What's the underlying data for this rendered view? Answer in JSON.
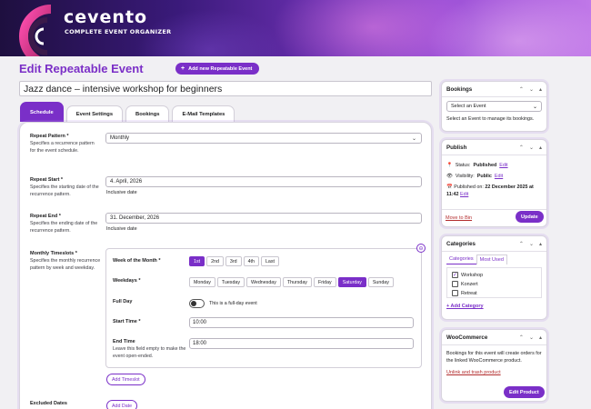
{
  "brand": {
    "name": "cevento",
    "tagline": "COMPLETE EVENT ORGANIZER",
    "accent": "#7a2fc8"
  },
  "header": {
    "title": "Edit Repeatable Event",
    "add_new_label": "Add new Repeatable Event"
  },
  "event_title": "Jazz dance – intensive workshop for beginners",
  "tabs": [
    {
      "label": "Schedule",
      "active": true
    },
    {
      "label": "Event Settings",
      "active": false
    },
    {
      "label": "Bookings",
      "active": false
    },
    {
      "label": "E-Mail Templates",
      "active": false
    }
  ],
  "schedule": {
    "repeat_pattern": {
      "label": "Repeat Pattern *",
      "desc": "Specifies a recurrence pattern for the event schedule.",
      "value": "Monthly"
    },
    "repeat_start": {
      "label": "Repeat Start *",
      "desc": "Specifies the starting date of the recurrence pattern.",
      "value": "4. April, 2026",
      "hint": "Inclusive date"
    },
    "repeat_end": {
      "label": "Repeat End *",
      "desc": "Specifies the ending date of the recurrence pattern.",
      "value": "31. December, 2026",
      "hint": "Inclusive date"
    },
    "timeslots": {
      "label": "Monthly Timeslots *",
      "desc": "Specifies the monthly recurrence pattern by week and weekday.",
      "week_label": "Week of the Month *",
      "weeks": [
        "1st",
        "2nd",
        "3rd",
        "4th",
        "Last"
      ],
      "week_selected": "1st",
      "weekdays_label": "Weekdays *",
      "weekdays": [
        "Monday",
        "Tuesday",
        "Wednesday",
        "Thursday",
        "Friday",
        "Saturday",
        "Sunday"
      ],
      "weekday_selected": "Saturday",
      "full_day_label": "Full Day",
      "full_day_text": "This is a full-day event",
      "start_label": "Start Time *",
      "start_value": "10:00",
      "end_label": "End Time",
      "end_desc": "Leave this field empty to make the event open-ended.",
      "end_value": "18:00",
      "add_timeslot": "Add Timeslot"
    },
    "excluded": {
      "label": "Excluded Dates",
      "add_date": "Add Date"
    }
  },
  "sidebar": {
    "bookings": {
      "title": "Bookings",
      "select_value": "Select an Event",
      "text": "Select an Event to manage its bookings."
    },
    "publish": {
      "title": "Publish",
      "status_label": "Status:",
      "status_value": "Published",
      "edit": "Edit",
      "visibility_label": "Visibility:",
      "visibility_value": "Public",
      "published_label": "Published on:",
      "published_value": "22 December 2025 at 11:42",
      "move_to_bin": "Move to Bin",
      "update": "Update"
    },
    "categories": {
      "title": "Categories",
      "tab_all": "Categories",
      "tab_most_used": "Most Used",
      "items": [
        {
          "label": "Workshop",
          "checked": true
        },
        {
          "label": "Konzert",
          "checked": false
        },
        {
          "label": "Retreat",
          "checked": false
        }
      ],
      "add_category": "+ Add Category"
    },
    "woocommerce": {
      "title": "WooCommerce",
      "text": "Bookings for this event will create orders for the linked WooCommerce product.",
      "unlink": "Unlink and trash product",
      "edit_product": "Edit Product"
    }
  }
}
